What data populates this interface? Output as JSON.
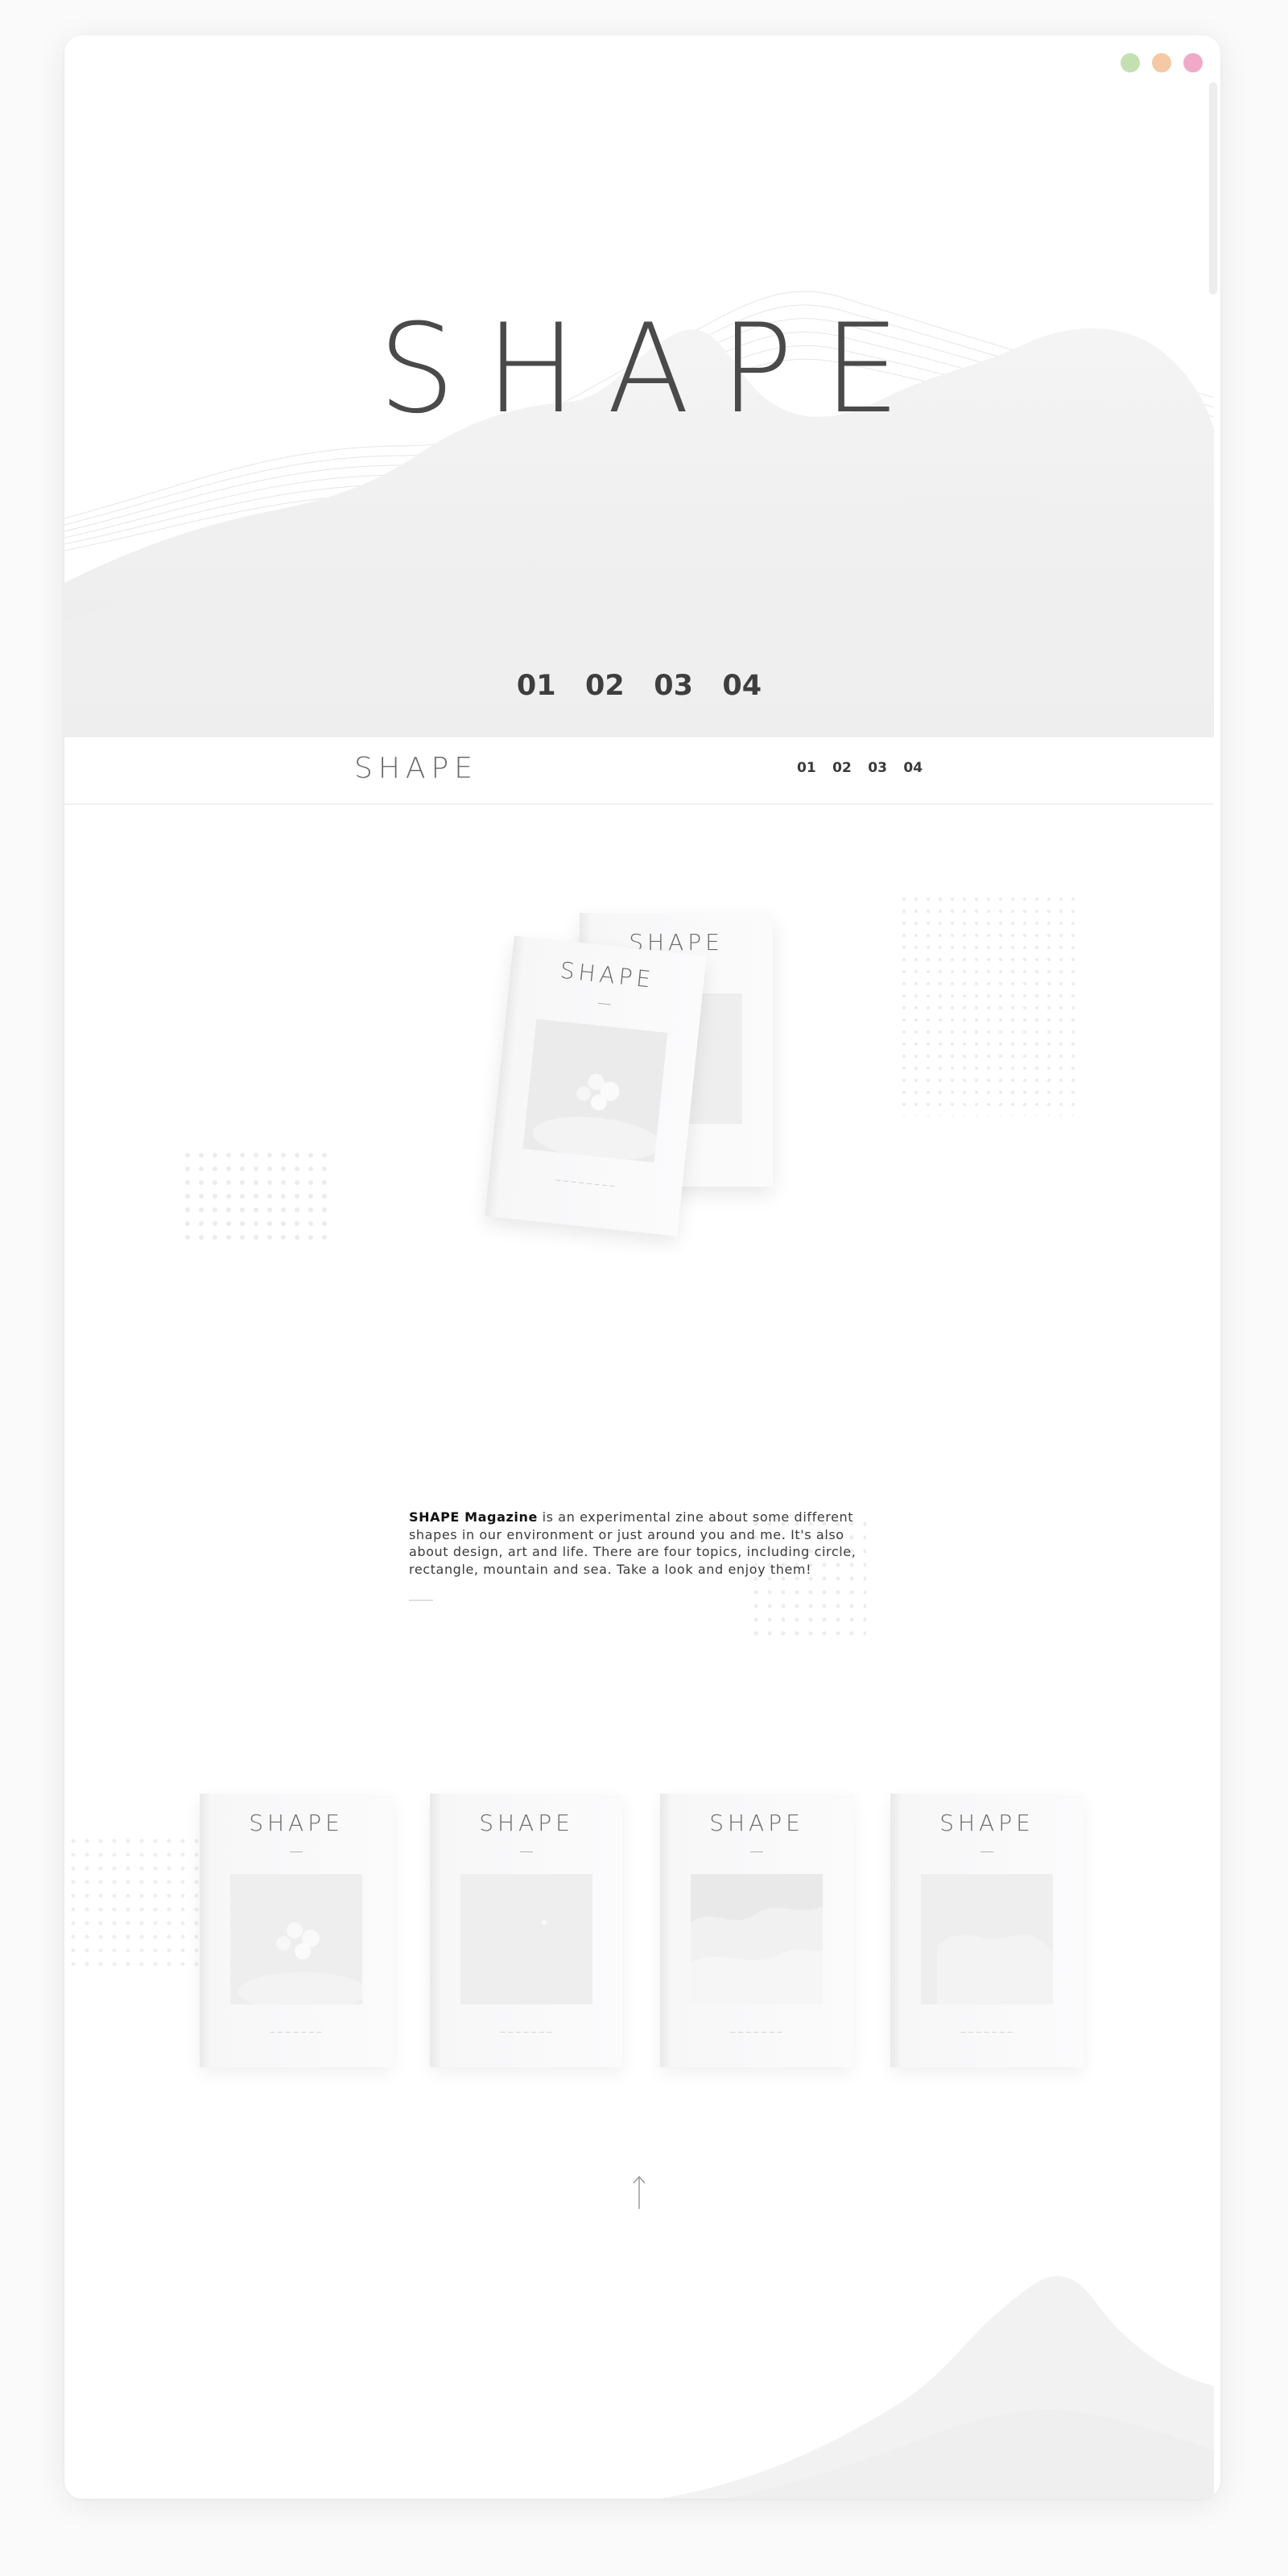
{
  "window": {
    "controls": [
      {
        "name": "green",
        "color": "#c3e1b0"
      },
      {
        "name": "orange",
        "color": "#f6c8a4"
      },
      {
        "name": "pink",
        "color": "#f1a9c9"
      }
    ]
  },
  "hero": {
    "title": "SHAPE",
    "nav": [
      "01",
      "02",
      "03",
      "04"
    ]
  },
  "subheader": {
    "logo": "SHAPE",
    "nav": [
      "01",
      "02",
      "03",
      "04"
    ]
  },
  "featured": {
    "front_cover_title": "SHAPE",
    "back_cover_title": "SHAPE"
  },
  "about": {
    "brand": "SHAPE Magazine",
    "text": " is an experimental zine about some different shapes in our environment or just around you and me. It's also about design, art and life. There are four topics, including circle, rectangle, mountain and sea. Take a look and enjoy them!"
  },
  "issues": [
    {
      "title": "SHAPE",
      "topic": "circle-spheres"
    },
    {
      "title": "SHAPE",
      "topic": "dot"
    },
    {
      "title": "SHAPE",
      "topic": "mountain"
    },
    {
      "title": "SHAPE",
      "topic": "sea"
    }
  ],
  "footer": {
    "up_icon": "up-arrow-icon"
  }
}
